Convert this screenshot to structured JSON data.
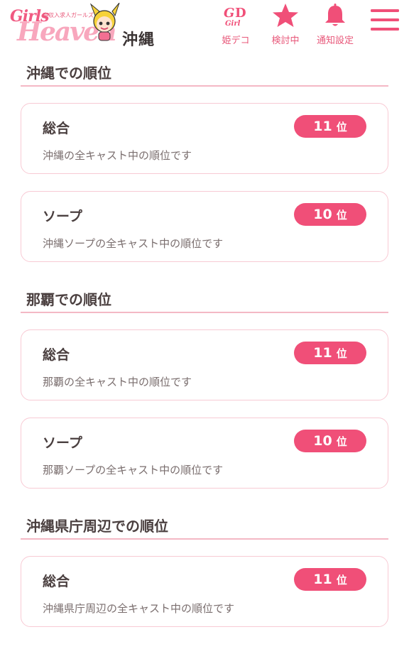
{
  "header": {
    "logo": {
      "tagline": "高収入求人ガールズ",
      "word_top": "Girls",
      "word_main": "Heaven",
      "region": "沖縄"
    },
    "nav": {
      "deco_label": "姫デコ",
      "deco_icon_text": "GD",
      "favorite_label": "検討中",
      "notify_label": "通知設定"
    },
    "menu_icon": "hamburger-menu-icon"
  },
  "colors": {
    "accent": "#f04f78",
    "nav_text": "#e8587a",
    "card_border": "#f8cad4",
    "title_underline": "#f4b8c5"
  },
  "sections": [
    {
      "title": "沖縄での順位",
      "cards": [
        {
          "name": "総合",
          "rank": "11",
          "unit": "位",
          "desc": "沖縄の全キャスト中の順位です"
        },
        {
          "name": "ソープ",
          "rank": "10",
          "unit": "位",
          "desc": "沖縄ソープの全キャスト中の順位です"
        }
      ]
    },
    {
      "title": "那覇での順位",
      "cards": [
        {
          "name": "総合",
          "rank": "11",
          "unit": "位",
          "desc": "那覇の全キャスト中の順位です"
        },
        {
          "name": "ソープ",
          "rank": "10",
          "unit": "位",
          "desc": "那覇ソープの全キャスト中の順位です"
        }
      ]
    },
    {
      "title": "沖縄県庁周辺での順位",
      "cards": [
        {
          "name": "総合",
          "rank": "11",
          "unit": "位",
          "desc": "沖縄県庁周辺の全キャスト中の順位です"
        }
      ]
    }
  ]
}
